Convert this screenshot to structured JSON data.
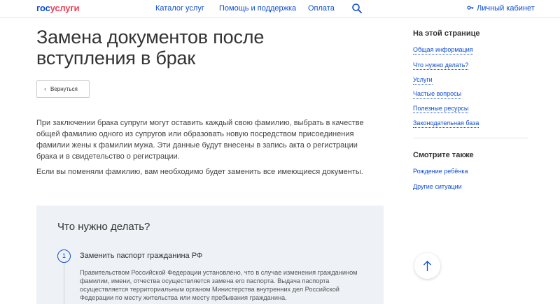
{
  "header": {
    "logo_part1": "гос",
    "logo_part2": "услуги",
    "nav": [
      {
        "label": "Каталог услуг"
      },
      {
        "label": "Помощь и поддержка"
      },
      {
        "label": "Оплата"
      }
    ],
    "search_icon": "search-icon",
    "cabinet_label": "Личный кабинет",
    "cabinet_icon": "key-icon"
  },
  "main": {
    "title": "Замена документов после вступления в брак",
    "back_label": "Вернуться",
    "intro_p1": "При заключении брака супруги могут оставить каждый свою фамилию, выбрать в качестве общей фамилию одного из супругов или образовать новую посредством присоединения фамилии жены к фамилии мужа. Эти данные будут внесены в запись акта о регистрации брака и в свидетельство о регистрации.",
    "intro_p2": "Если вы поменяли фамилию, вам необходимо будет заменить все имеющиеся документы."
  },
  "todo": {
    "title": "Что нужно делать?",
    "steps": [
      {
        "number": "1",
        "title": "Заменить паспорт гражданина РФ",
        "text": "Правительством Российской Федерации установлено, что в случае изменения гражданином фамилии, имени, отчества осуществляется замена его паспорта. Выдача паспорта осуществляется территориальным органом Министерства внутренних дел Российской Федерации по месту жительства или месту пребывания гражданина."
      }
    ]
  },
  "sidebar": {
    "on_page_title": "На этой странице",
    "on_page_links": [
      {
        "label": "Общая информация"
      },
      {
        "label": "Что нужно делать?"
      },
      {
        "label": "Услуги"
      },
      {
        "label": "Частые вопросы"
      },
      {
        "label": "Полезные ресурсы"
      },
      {
        "label": "Законодательная база"
      }
    ],
    "see_also_title": "Смотрите также",
    "see_also_links": [
      {
        "label": "Рождение ребёнка"
      },
      {
        "label": "Другие ситуации"
      }
    ]
  },
  "colors": {
    "brand_blue": "#0d4cd3",
    "brand_red": "#ee3f58",
    "block_bg": "#eef2f6"
  }
}
